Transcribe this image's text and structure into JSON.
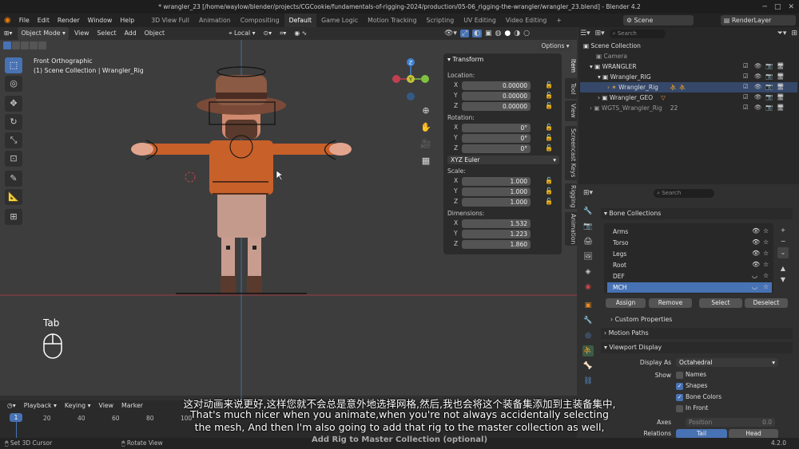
{
  "window": {
    "title": "* wrangler_23 [/home/waylow/blender/projects/CGCookie/fundamentals-of-rigging-2024/production/05-06_rigging-the-wrangler/wrangler_23.blend] - Blender 4.2"
  },
  "menu": [
    "File",
    "Edit",
    "Render",
    "Window",
    "Help"
  ],
  "workspaces": [
    "3D View Full",
    "Animation",
    "Compositing",
    "Default",
    "Game Logic",
    "Motion Tracking",
    "Scripting",
    "UV Editing",
    "Video Editing"
  ],
  "workspace_active": "Default",
  "scene": {
    "label": "Scene",
    "render_layer": "RenderLayer"
  },
  "viewport_header": {
    "mode": "Object Mode",
    "menus": [
      "View",
      "Select",
      "Add",
      "Object"
    ],
    "transform_orientation": "Local",
    "options_label": "Options"
  },
  "viewport_overlay": {
    "view_name": "Front Orthographic",
    "collection_info": "(1) Scene Collection | Wrangler_Rig",
    "key_hint": "Tab"
  },
  "npanel": {
    "header": "Transform",
    "location_label": "Location:",
    "location": [
      {
        "axis": "X",
        "value": "0.00000"
      },
      {
        "axis": "Y",
        "value": "0.00000"
      },
      {
        "axis": "Z",
        "value": "0.00000"
      }
    ],
    "rotation_label": "Rotation:",
    "rotation": [
      {
        "axis": "X",
        "value": "0°"
      },
      {
        "axis": "Y",
        "value": "0°"
      },
      {
        "axis": "Z",
        "value": "0°"
      }
    ],
    "rotation_mode": "XYZ Euler",
    "scale_label": "Scale:",
    "scale": [
      {
        "axis": "X",
        "value": "1.000"
      },
      {
        "axis": "Y",
        "value": "1.000"
      },
      {
        "axis": "Z",
        "value": "1.000"
      }
    ],
    "dimensions_label": "Dimensions:",
    "dimensions": [
      {
        "axis": "X",
        "value": "1.532"
      },
      {
        "axis": "Y",
        "value": "1.223"
      },
      {
        "axis": "Z",
        "value": "1.860"
      }
    ],
    "tabs": [
      "Item",
      "Tool",
      "View",
      "Screencast Keys",
      "Rigging",
      "Animation"
    ]
  },
  "outliner": {
    "search_placeholder": "Search",
    "rows": [
      {
        "label": "Scene Collection"
      },
      {
        "label": "Camera"
      },
      {
        "label": "WRANGLER"
      },
      {
        "label": "Wrangler_RIG"
      },
      {
        "label": "Wrangler_Rig"
      },
      {
        "label": "Wrangler_GEO"
      },
      {
        "label": "WGTS_Wrangler_Rig",
        "badge": "22"
      }
    ]
  },
  "properties": {
    "search_placeholder": "Search",
    "bone_collections_header": "Bone Collections",
    "bone_collections": [
      "Arms",
      "Torso",
      "Legs",
      "Root",
      "DEF",
      "MCH"
    ],
    "selected_collection": "MCH",
    "buttons": [
      "Assign",
      "Remove",
      "Select",
      "Deselect"
    ],
    "custom_properties": "Custom Properties",
    "motion_paths": "Motion Paths",
    "viewport_display": "Viewport Display",
    "display_as_label": "Display As",
    "display_as_value": "Octahedral",
    "show_label": "Show",
    "show_options": [
      {
        "label": "Names",
        "checked": false
      },
      {
        "label": "Shapes",
        "checked": true
      },
      {
        "label": "Bone Colors",
        "checked": true
      },
      {
        "label": "In Front",
        "checked": false
      }
    ],
    "axes_label": "Axes",
    "position_label": "Position",
    "position_value": "0.0",
    "relations_label": "Relations",
    "relations_options": [
      "Tail",
      "Head"
    ]
  },
  "timeline": {
    "menus": [
      "Playback",
      "Keying",
      "View",
      "Marker"
    ],
    "current_frame": "1",
    "ticks": [
      "20",
      "40",
      "60",
      "80",
      "100"
    ]
  },
  "status_bar": {
    "left": "Set 3D Cursor",
    "middle": "Rotate View",
    "right": "4.2.0"
  },
  "subtitles": {
    "chinese": "这对动画来说更好,这样您就不会总是意外地选择网格,然后,我也会将这个装备集添加到主装备集中,",
    "english_line1": "That's much nicer when you animate,when you're not always accidentally selecting",
    "english_line2": "the mesh, And then I'm also going to add that rig to the master collection as well,",
    "chapter": "Add Rig to Master Collection (optional)"
  },
  "colors": {
    "accent": "#4772b3",
    "x_axis": "#c04050",
    "y_axis": "#80c040",
    "z_axis": "#4080d0",
    "shirt": "#c8602a"
  }
}
